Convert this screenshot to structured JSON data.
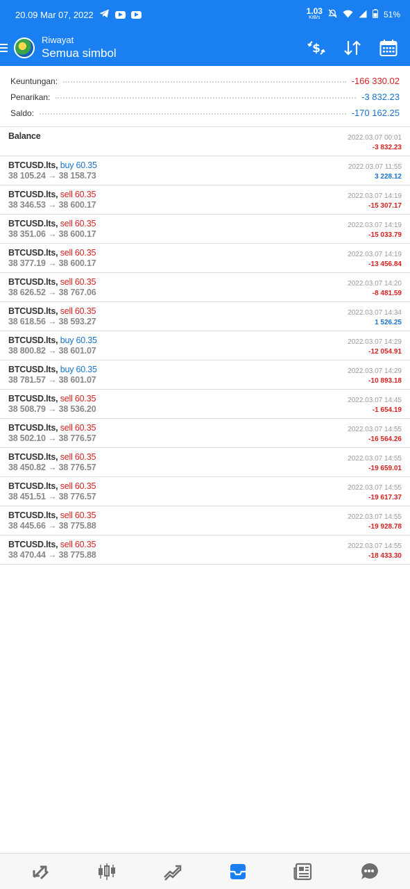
{
  "status_bar": {
    "time": "20.09 Mar 07, 2022",
    "net_speed": "1.03",
    "net_unit": "KiB/s",
    "battery": "51%"
  },
  "header": {
    "subtitle": "Riwayat",
    "title": "Semua simbol",
    "actions": [
      "currency-exchange-icon",
      "sort-icon",
      "calendar-icon"
    ]
  },
  "summary": {
    "profit_label": "Keuntungan:",
    "profit_value": "-166 330.02",
    "withdrawal_label": "Penarikan:",
    "withdrawal_value": "-3 832.23",
    "balance_label": "Saldo:",
    "balance_value": "-170 162.25"
  },
  "balance_entry": {
    "label": "Balance",
    "time": "2022.03.07 00:01",
    "amount": "-3 832.23"
  },
  "deals": [
    {
      "symbol": "BTCUSD.lts,",
      "type": "buy 60.35",
      "prices": "38 105.24 → 38 158.73",
      "time": "2022.03.07 11:55",
      "profit": "3 228.12",
      "side": "buy",
      "positive": true
    },
    {
      "symbol": "BTCUSD.lts,",
      "type": "sell 60.35",
      "prices": "38 346.53 → 38 600.17",
      "time": "2022.03.07 14:19",
      "profit": "-15 307.17",
      "side": "sell",
      "positive": false
    },
    {
      "symbol": "BTCUSD.lts,",
      "type": "sell 60.35",
      "prices": "38 351.06 → 38 600.17",
      "time": "2022.03.07 14:19",
      "profit": "-15 033.79",
      "side": "sell",
      "positive": false
    },
    {
      "symbol": "BTCUSD.lts,",
      "type": "sell 60.35",
      "prices": "38 377.19 → 38 600.17",
      "time": "2022.03.07 14:19",
      "profit": "-13 456.84",
      "side": "sell",
      "positive": false
    },
    {
      "symbol": "BTCUSD.lts,",
      "type": "sell 60.35",
      "prices": "38 626.52 → 38 767.06",
      "time": "2022.03.07 14:20",
      "profit": "-8 481.59",
      "side": "sell",
      "positive": false
    },
    {
      "symbol": "BTCUSD.lts,",
      "type": "sell 60.35",
      "prices": "38 618.56 → 38 593.27",
      "time": "2022.03.07 14:34",
      "profit": "1 526.25",
      "side": "sell",
      "positive": true
    },
    {
      "symbol": "BTCUSD.lts,",
      "type": "buy 60.35",
      "prices": "38 800.82 → 38 601.07",
      "time": "2022.03.07 14:29",
      "profit": "-12 054.91",
      "side": "buy",
      "positive": false
    },
    {
      "symbol": "BTCUSD.lts,",
      "type": "buy 60.35",
      "prices": "38 781.57 → 38 601.07",
      "time": "2022.03.07 14:29",
      "profit": "-10 893.18",
      "side": "buy",
      "positive": false
    },
    {
      "symbol": "BTCUSD.lts,",
      "type": "sell 60.35",
      "prices": "38 508.79 → 38 536.20",
      "time": "2022.03.07 14:45",
      "profit": "-1 654.19",
      "side": "sell",
      "positive": false
    },
    {
      "symbol": "BTCUSD.lts,",
      "type": "sell 60.35",
      "prices": "38 502.10 → 38 776.57",
      "time": "2022.03.07 14:55",
      "profit": "-16 564.26",
      "side": "sell",
      "positive": false
    },
    {
      "symbol": "BTCUSD.lts,",
      "type": "sell 60.35",
      "prices": "38 450.82 → 38 776.57",
      "time": "2022.03.07 14:55",
      "profit": "-19 659.01",
      "side": "sell",
      "positive": false
    },
    {
      "symbol": "BTCUSD.lts,",
      "type": "sell 60.35",
      "prices": "38 451.51 → 38 776.57",
      "time": "2022.03.07 14:55",
      "profit": "-19 617.37",
      "side": "sell",
      "positive": false
    },
    {
      "symbol": "BTCUSD.lts,",
      "type": "sell 60.35",
      "prices": "38 445.66 → 38 775.88",
      "time": "2022.03.07 14:55",
      "profit": "-19 928.78",
      "side": "sell",
      "positive": false
    },
    {
      "symbol": "BTCUSD.lts,",
      "type": "sell 60.35",
      "prices": "38 470.44 → 38 775.88",
      "time": "2022.03.07 14:55",
      "profit": "-18 433.30",
      "side": "sell",
      "positive": false
    }
  ],
  "bottom_nav": [
    "quotes-icon",
    "chart-icon",
    "trade-icon",
    "history-icon",
    "news-icon",
    "chat-icon"
  ],
  "colors": {
    "accent": "#1a7ff0",
    "sell_red": "#d71f1f",
    "buy_blue": "#1873cc",
    "active_nav": "#1a7ff0",
    "inactive_nav": "#6e6e6e"
  }
}
